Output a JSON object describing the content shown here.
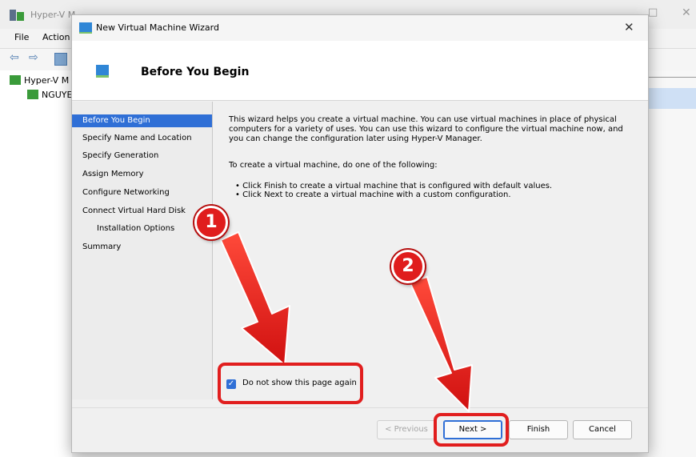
{
  "background_window": {
    "title": "Hyper-V M",
    "menu": [
      "File",
      "Action"
    ],
    "tree": [
      "Hyper-V M",
      "NGUYE"
    ]
  },
  "dialog": {
    "title": "New Virtual Machine Wizard",
    "header_title": "Before You Begin",
    "nav_items": [
      {
        "label": "Before You Begin",
        "active": true
      },
      {
        "label": "Specify Name and Location"
      },
      {
        "label": "Specify Generation"
      },
      {
        "label": "Assign Memory"
      },
      {
        "label": "Configure Networking"
      },
      {
        "label": "Connect Virtual Hard Disk"
      },
      {
        "label": "Installation Options"
      },
      {
        "label": "Summary"
      }
    ],
    "content": {
      "intro": "This wizard helps you create a virtual machine. You can use virtual machines in place of physical computers for a variety of uses. You can use this wizard to configure the virtual machine now, and you can change the configuration later using Hyper-V Manager.",
      "instruction": "To create a virtual machine, do one of the following:",
      "bullets": [
        "• Click Finish to create a virtual machine that is configured with default values.",
        "• Click Next to create a virtual machine with a custom configuration."
      ]
    },
    "checkbox": {
      "label": "Do not show this page again",
      "checked": true
    },
    "buttons": {
      "previous": "< Previous",
      "next": "Next >",
      "finish": "Finish",
      "cancel": "Cancel"
    }
  },
  "annotations": {
    "markers": [
      "1",
      "2"
    ],
    "color": "#e11e1e"
  },
  "colors": {
    "selection": "#2f6fd6",
    "annotation": "#e11e1e"
  }
}
